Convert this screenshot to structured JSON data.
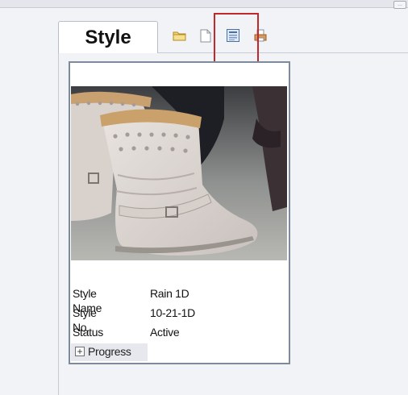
{
  "tab": {
    "label": "Style"
  },
  "toolbar": {
    "icons": [
      "folder-icon",
      "new-document-icon",
      "detail-view-icon",
      "print-icon"
    ]
  },
  "card": {
    "image_alt": "boot-photo",
    "fields": [
      {
        "label": "Style Name",
        "value": "Rain 1D"
      },
      {
        "label": "Style No.",
        "value": "10-21-1D"
      },
      {
        "label": "Status",
        "value": "Active"
      }
    ],
    "progress": {
      "label": "Progress",
      "expander_symbol": "+"
    }
  },
  "colors": {
    "highlight": "#c0282c",
    "card_border": "#7d8b9c"
  }
}
